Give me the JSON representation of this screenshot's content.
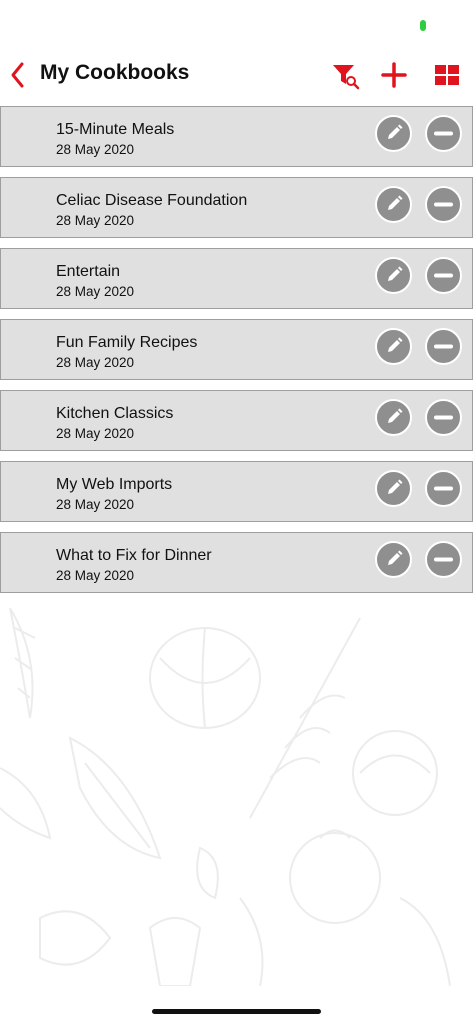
{
  "header": {
    "title": "My Cookbooks"
  },
  "colors": {
    "accent": "#e0141e",
    "row_background": "#e0e0e0",
    "action_button": "#8f8f8f",
    "battery": "#2ecc40"
  },
  "icons": {
    "back": "chevron-left-icon",
    "filter": "filter-search-icon",
    "add": "plus-icon",
    "grid": "grid-view-icon",
    "edit": "pencil-icon",
    "delete": "minus-icon"
  },
  "cookbooks": [
    {
      "name": "15-Minute Meals",
      "date": "28 May 2020"
    },
    {
      "name": "Celiac Disease Foundation",
      "date": "28 May 2020"
    },
    {
      "name": "Entertain",
      "date": "28 May 2020"
    },
    {
      "name": "Fun Family Recipes",
      "date": "28 May 2020"
    },
    {
      "name": "Kitchen Classics",
      "date": "28 May 2020"
    },
    {
      "name": "My Web Imports",
      "date": "28 May 2020"
    },
    {
      "name": "What to Fix for Dinner",
      "date": "28 May 2020"
    }
  ]
}
